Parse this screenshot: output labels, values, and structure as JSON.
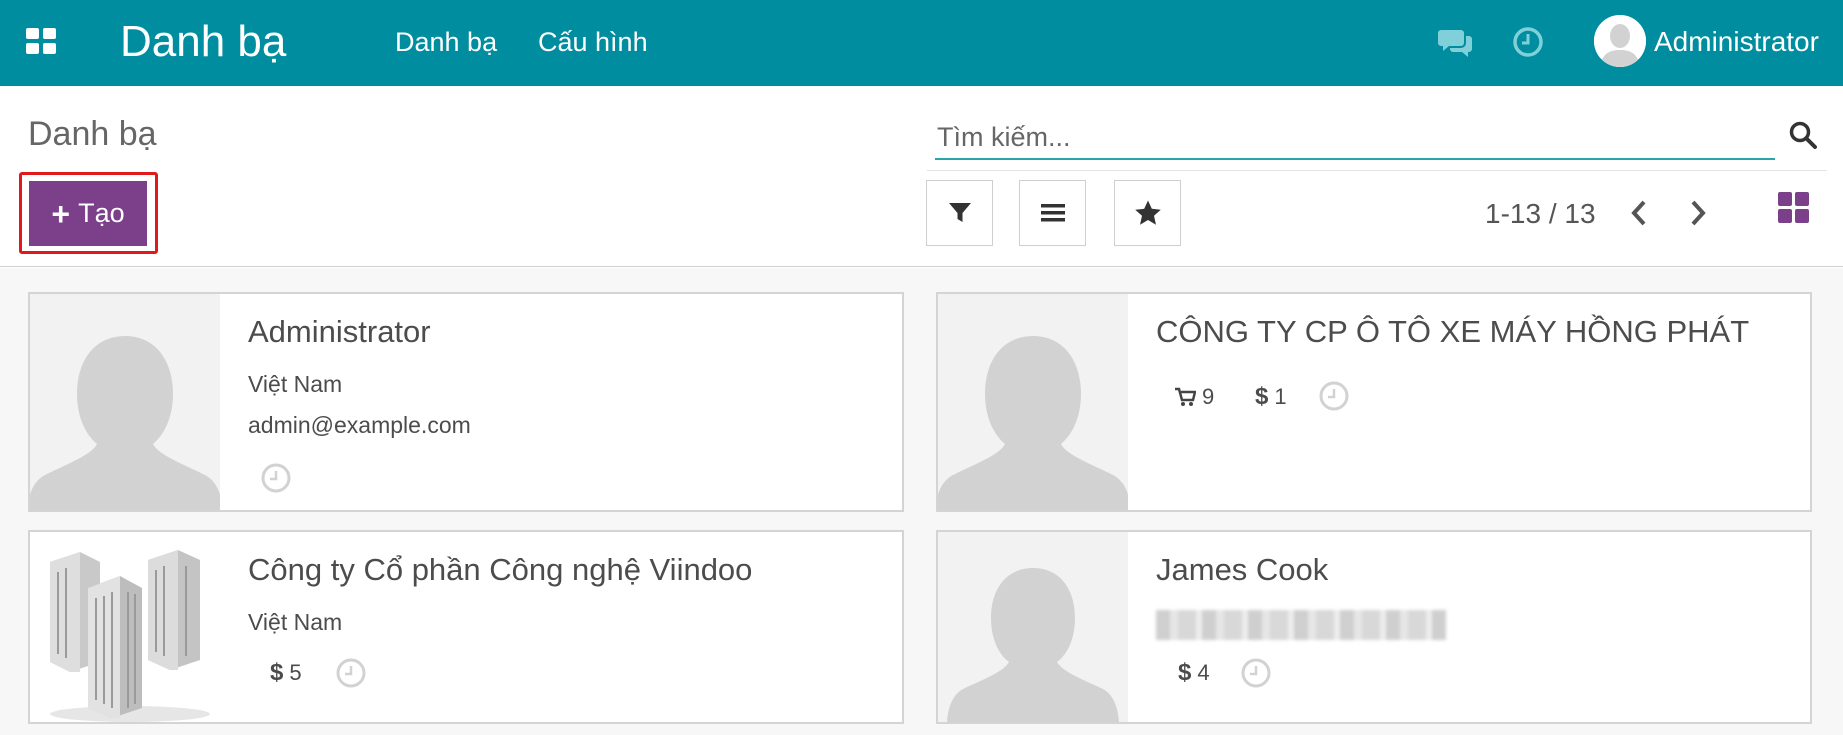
{
  "navbar": {
    "app_title": "Danh bạ",
    "menu": [
      "Danh bạ",
      "Cấu hình"
    ],
    "user_name": "Administrator",
    "color": "#008d9f"
  },
  "control_panel": {
    "breadcrumb": "Danh bạ",
    "create_label": "Tạo",
    "create_color": "#7c3f8a",
    "search_placeholder": "Tìm kiếm...",
    "pager": "1-13 / 13",
    "icons": [
      "filter-icon",
      "group-by-icon",
      "favorites-icon",
      "kanban-view-icon"
    ]
  },
  "cards": [
    {
      "name": "Administrator",
      "country": "Việt Nam",
      "email": "admin@example.com",
      "image": "person-placeholder"
    },
    {
      "name": "CÔNG TY CP Ô TÔ XE MÁY HỒNG PHÁT",
      "sales_count": "9",
      "invoice_count": "1",
      "image": "person-placeholder"
    },
    {
      "name": "Công ty Cổ phần Công nghệ Viindoo",
      "country": "Việt Nam",
      "invoice_count": "5",
      "image": "company-buildings"
    },
    {
      "name": "James Cook",
      "invoice_count": "4",
      "image": "person-placeholder"
    }
  ]
}
